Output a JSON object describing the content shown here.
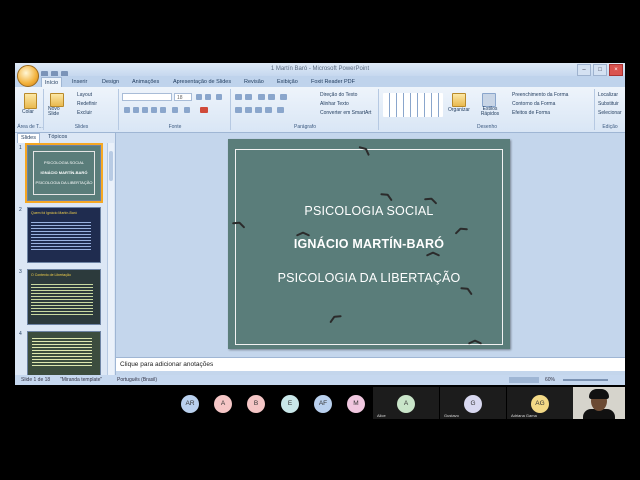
{
  "window": {
    "title": "1 Martín Baró - Microsoft PowerPoint",
    "controls": [
      "–",
      "□",
      "×"
    ]
  },
  "ribbon_tabs": [
    "Início",
    "Inserir",
    "Design",
    "Animações",
    "Apresentação de Slides",
    "Revisão",
    "Exibição",
    "Foxit Reader PDF"
  ],
  "ribbon": {
    "clipboard": {
      "paste": "Colar",
      "label": "Área de T..."
    },
    "slides": {
      "new_slide": "Novo Slide",
      "layout": "Layout",
      "reset": "Redefinir",
      "delete": "Excluir",
      "label": "Slides"
    },
    "font": {
      "label": "Fonte",
      "size": "18"
    },
    "paragraph": {
      "label": "Parágrafo",
      "text_direction": "Direção do Texto",
      "align_text": "Alinhar Texto",
      "smartart": "Converter em SmartArt"
    },
    "drawing": {
      "label": "Desenho",
      "arrange": "Organizar",
      "quick_styles": "Estilos Rápidos",
      "shape_fill": "Preenchimento da Forma",
      "shape_outline": "Contorno da Forma",
      "shape_effects": "Efeitos de Forma"
    },
    "editing": {
      "label": "Edição",
      "find": "Localizar",
      "replace": "Substituir",
      "select": "Selecionar"
    }
  },
  "left_pane": {
    "tabs": [
      "Slides",
      "Tópicos"
    ],
    "thumbnails": [
      {
        "num": "1",
        "lines": [
          "PSICOLOGIA SOCIAL",
          "IGNÁCIO MARTÍN-BARÓ",
          "PSICOLOGIA DA LIBERTAÇÃO"
        ]
      },
      {
        "num": "2",
        "lines": [
          "Quem foi Ignácio Martín-Baró"
        ]
      },
      {
        "num": "3",
        "lines": [
          "O Contexto de Libertação"
        ]
      },
      {
        "num": "4",
        "lines": [
          "..."
        ]
      }
    ]
  },
  "slide": {
    "line1": "PSICOLOGIA SOCIAL",
    "line2": "IGNÁCIO MARTÍN-BARÓ",
    "line3": "PSICOLOGIA DA LIBERTAÇÃO"
  },
  "notes": {
    "placeholder": "Clique para adicionar anotações"
  },
  "status": {
    "slide": "Slide 1 de 18",
    "theme": "\"Miranda template\"",
    "language": "Português (Brasil)",
    "zoom": "60%"
  },
  "participants": [
    {
      "initials": "AR",
      "color": "#b9d0ee"
    },
    {
      "initials": "A",
      "color": "#f5c6c6"
    },
    {
      "initials": "B",
      "color": "#f5c6c6"
    },
    {
      "initials": "E",
      "color": "#c9e7e9"
    },
    {
      "initials": "AF",
      "color": "#b9d0ee"
    },
    {
      "initials": "M",
      "color": "#f0c7df"
    }
  ],
  "tiles": [
    {
      "initials": "A",
      "name": "Alice",
      "color": "#c9e5c9"
    },
    {
      "initials": "G",
      "name": "Gustavo",
      "color": "#d8d8f0"
    },
    {
      "initials": "AG",
      "name": "Adriana Gama",
      "color": "#f3d986"
    }
  ]
}
